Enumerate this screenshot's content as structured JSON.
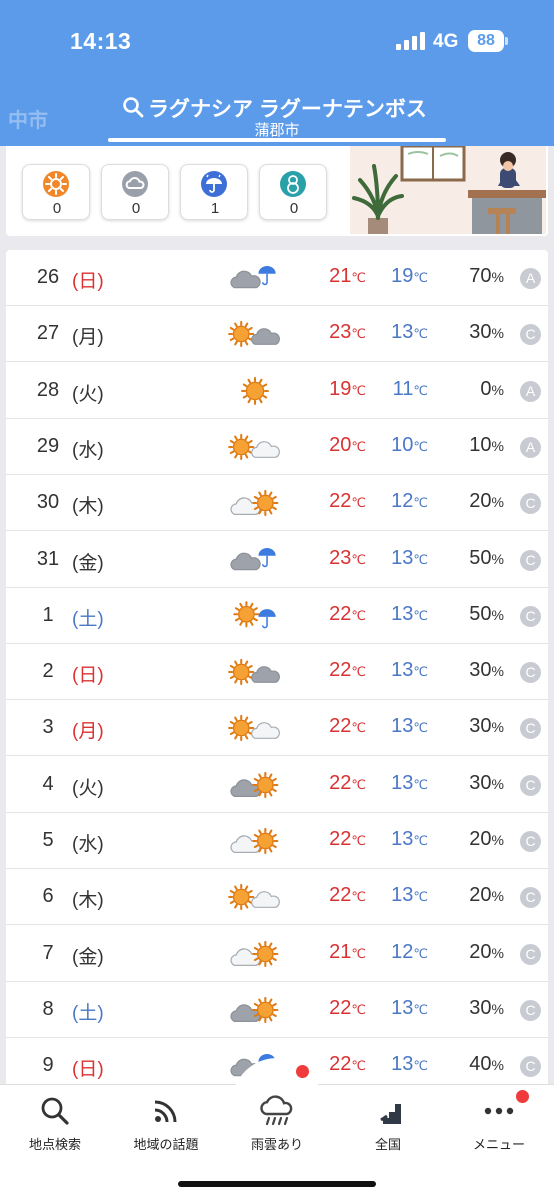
{
  "status_bar": {
    "time": "14:13",
    "network": "4G",
    "battery": "88"
  },
  "header": {
    "ghost_city": "中市",
    "search_title": "ラグナシア ラグーナテンボス",
    "search_subtitle": "蒲郡市"
  },
  "summary": {
    "counts": [
      {
        "icon": "sun-badge-icon",
        "value": "0"
      },
      {
        "icon": "cloud-badge-icon",
        "value": "0"
      },
      {
        "icon": "umbrella-badge-icon",
        "value": "1"
      },
      {
        "icon": "snowman-badge-icon",
        "value": "0"
      }
    ]
  },
  "forecast": [
    {
      "day": "26",
      "weekday": "(日)",
      "weekday_color": "#d93232",
      "weather": "cloud-rain",
      "high": "21",
      "low": "19",
      "unit": "℃",
      "pop": "70",
      "pop_unit": "%",
      "grade": "A"
    },
    {
      "day": "27",
      "weekday": "(月)",
      "weekday_color": "#333333",
      "weather": "sun-cloud",
      "high": "23",
      "low": "13",
      "unit": "℃",
      "pop": "30",
      "pop_unit": "%",
      "grade": "C"
    },
    {
      "day": "28",
      "weekday": "(火)",
      "weekday_color": "#333333",
      "weather": "sun",
      "high": "19",
      "low": "11",
      "unit": "℃",
      "pop": "0",
      "pop_unit": "%",
      "grade": "A"
    },
    {
      "day": "29",
      "weekday": "(水)",
      "weekday_color": "#333333",
      "weather": "sun-lightcloud",
      "high": "20",
      "low": "10",
      "unit": "℃",
      "pop": "10",
      "pop_unit": "%",
      "grade": "A"
    },
    {
      "day": "30",
      "weekday": "(木)",
      "weekday_color": "#333333",
      "weather": "lightcloud-sun",
      "high": "22",
      "low": "12",
      "unit": "℃",
      "pop": "20",
      "pop_unit": "%",
      "grade": "C"
    },
    {
      "day": "31",
      "weekday": "(金)",
      "weekday_color": "#333333",
      "weather": "cloud-rain",
      "high": "23",
      "low": "13",
      "unit": "℃",
      "pop": "50",
      "pop_unit": "%",
      "grade": "C"
    },
    {
      "day": "1",
      "weekday": "(土)",
      "weekday_color": "#4a78c4",
      "weather": "sun-rain",
      "high": "22",
      "low": "13",
      "unit": "℃",
      "pop": "50",
      "pop_unit": "%",
      "grade": "C"
    },
    {
      "day": "2",
      "weekday": "(日)",
      "weekday_color": "#d93232",
      "weather": "sun-cloud",
      "high": "22",
      "low": "13",
      "unit": "℃",
      "pop": "30",
      "pop_unit": "%",
      "grade": "C"
    },
    {
      "day": "3",
      "weekday": "(月)",
      "weekday_color": "#d93232",
      "weather": "sun-lightcloud",
      "high": "22",
      "low": "13",
      "unit": "℃",
      "pop": "30",
      "pop_unit": "%",
      "grade": "C"
    },
    {
      "day": "4",
      "weekday": "(火)",
      "weekday_color": "#333333",
      "weather": "cloud-sun",
      "high": "22",
      "low": "13",
      "unit": "℃",
      "pop": "30",
      "pop_unit": "%",
      "grade": "C"
    },
    {
      "day": "5",
      "weekday": "(水)",
      "weekday_color": "#333333",
      "weather": "lightcloud-sun",
      "high": "22",
      "low": "13",
      "unit": "℃",
      "pop": "20",
      "pop_unit": "%",
      "grade": "C"
    },
    {
      "day": "6",
      "weekday": "(木)",
      "weekday_color": "#333333",
      "weather": "sun-lightcloud",
      "high": "22",
      "low": "13",
      "unit": "℃",
      "pop": "20",
      "pop_unit": "%",
      "grade": "C"
    },
    {
      "day": "7",
      "weekday": "(金)",
      "weekday_color": "#333333",
      "weather": "lightcloud-sun",
      "high": "21",
      "low": "12",
      "unit": "℃",
      "pop": "20",
      "pop_unit": "%",
      "grade": "C"
    },
    {
      "day": "8",
      "weekday": "(土)",
      "weekday_color": "#4a78c4",
      "weather": "cloud-sun",
      "high": "22",
      "low": "13",
      "unit": "℃",
      "pop": "30",
      "pop_unit": "%",
      "grade": "C"
    },
    {
      "day": "9",
      "weekday": "(日)",
      "weekday_color": "#d93232",
      "weather": "cloud-rain",
      "high": "22",
      "low": "13",
      "unit": "℃",
      "pop": "40",
      "pop_unit": "%",
      "grade": "C"
    }
  ],
  "nav": [
    {
      "label": "地点検索",
      "icon": "search-icon",
      "badge": false
    },
    {
      "label": "地域の話題",
      "icon": "feed-icon",
      "badge": false
    },
    {
      "label": "雨雲あり",
      "icon": "rain-cloud-icon",
      "badge": true
    },
    {
      "label": "全国",
      "icon": "nationwide-icon",
      "badge": false
    },
    {
      "label": "メニュー",
      "icon": "more-icon",
      "badge": true
    }
  ],
  "colors": {
    "header_bg": "#5b9bea",
    "high_temp": "#d93232",
    "low_temp": "#4a78c4",
    "sun": "#f39a2b",
    "umbrella": "#3d7be0",
    "badge": "#ef3b3b"
  }
}
